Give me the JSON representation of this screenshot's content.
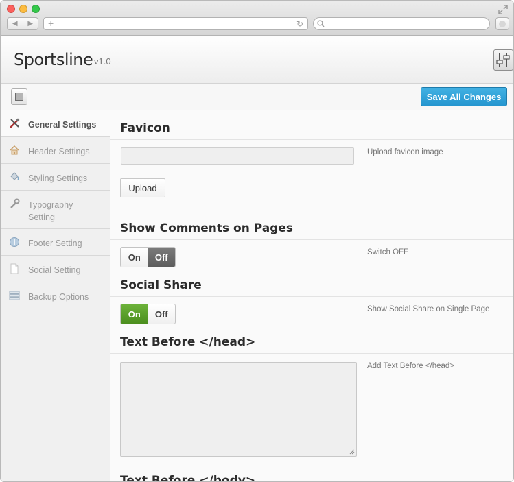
{
  "app": {
    "title": "Sportsline",
    "version": "v1.0"
  },
  "toolbar": {
    "save_label": "Save All Changes"
  },
  "sidebar": {
    "items": [
      {
        "label": "General Settings",
        "icon": "tools-icon",
        "active": true
      },
      {
        "label": "Header Settings",
        "icon": "home-icon",
        "active": false
      },
      {
        "label": "Styling Settings",
        "icon": "paint-bucket-icon",
        "active": false
      },
      {
        "label": "Typography Setting",
        "icon": "wrench-icon",
        "active": false
      },
      {
        "label": "Footer Setting",
        "icon": "info-icon",
        "active": false
      },
      {
        "label": "Social Setting",
        "icon": "document-icon",
        "active": false
      },
      {
        "label": "Backup Options",
        "icon": "database-icon",
        "active": false
      }
    ]
  },
  "main": {
    "favicon": {
      "title": "Favicon",
      "input_value": "",
      "description": "Upload favicon image",
      "upload_label": "Upload"
    },
    "comments": {
      "title": "Show Comments on Pages",
      "on_label": "On",
      "off_label": "Off",
      "state": "off",
      "description": "Switch OFF"
    },
    "social_share": {
      "title": "Social Share",
      "on_label": "On",
      "off_label": "Off",
      "state": "on",
      "description": "Show Social Share on Single Page"
    },
    "text_before_head": {
      "title": "Text Before </head>",
      "value": "",
      "description": "Add Text Before </head>"
    },
    "text_before_body": {
      "title": "Text Before </body>"
    }
  },
  "colors": {
    "accent": "#2495cf",
    "switch_on": "#4b8e1e",
    "switch_off": "#5d5d5d"
  }
}
